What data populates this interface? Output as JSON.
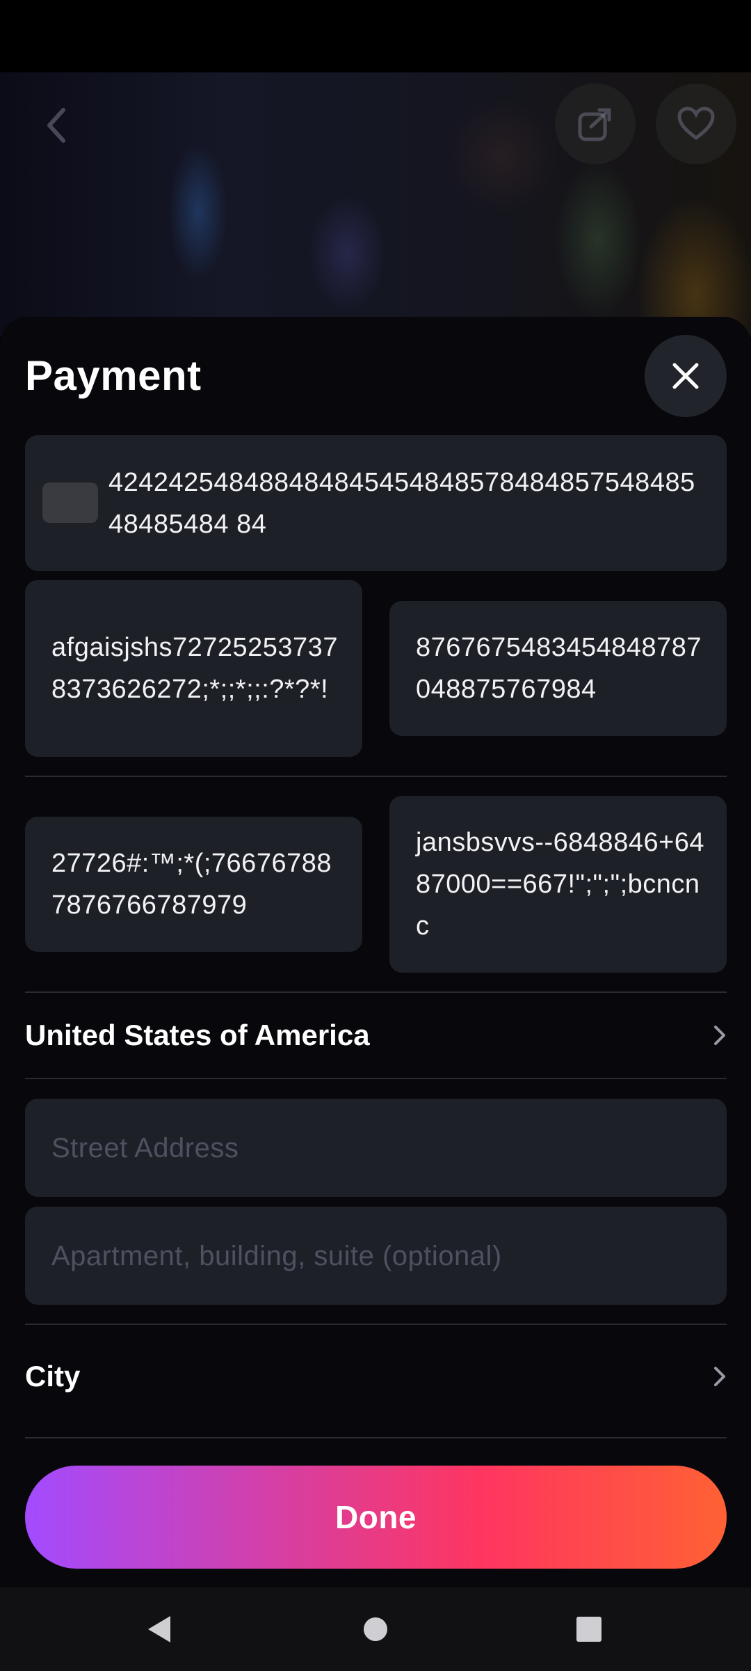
{
  "header": {
    "title": "Payment"
  },
  "card": {
    "number": "42424254848848484545484857848485754848548485484 84"
  },
  "fields": {
    "field_a": "afgaisjshs727252537378373626272;*;;*;;:?*?*!",
    "field_b": "8767675483454848787048875767984",
    "field_c": "27726#:™;*(;766767887876766787979",
    "field_d": "jansbsvvs--6848846+6487000==667!\";\";\";bcncnc"
  },
  "address": {
    "country": "United States of America",
    "street_placeholder": "Street Address",
    "apartment_placeholder": "Apartment, building, suite (optional)",
    "city_label": "City"
  },
  "actions": {
    "done_label": "Done"
  },
  "colors": {
    "sheet_bg": "#07070c",
    "field_bg": "#1e2028",
    "accent_start": "#a34bff",
    "accent_mid": "#ff3560",
    "accent_end": "#ff6134"
  },
  "icons": {
    "back": "back-arrow-icon",
    "share": "share-icon",
    "favorite": "heart-icon",
    "close": "close-icon",
    "chevron": "chevron-right-icon",
    "nav_back": "nav-back-icon",
    "nav_home": "nav-home-icon",
    "nav_recents": "nav-recents-icon"
  }
}
